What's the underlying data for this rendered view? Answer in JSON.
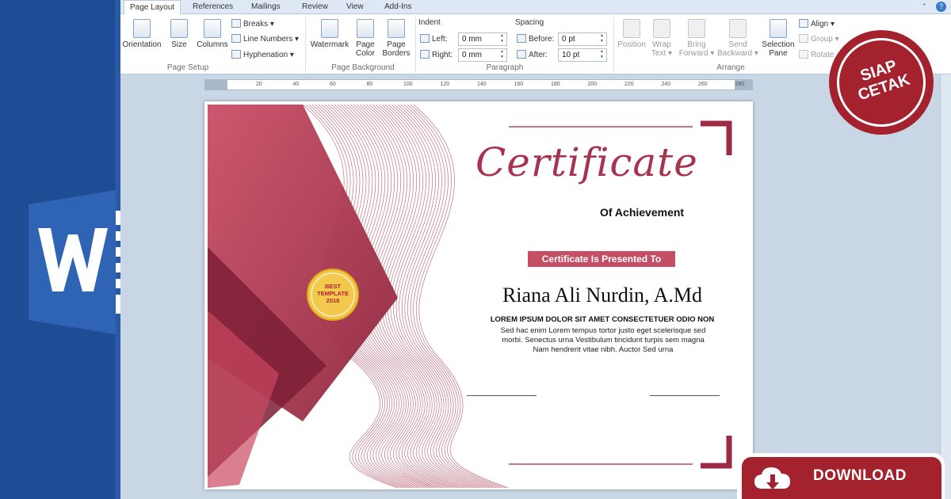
{
  "ribbon": {
    "tabs": [
      "Page Layout",
      "References",
      "Mailings",
      "Review",
      "View",
      "Add-Ins"
    ],
    "active_tab": "Page Layout",
    "page_setup": {
      "orientation": "Orientation",
      "size": "Size",
      "columns": "Columns",
      "breaks": "Breaks",
      "line_numbers": "Line Numbers",
      "hyphenation": "Hyphenation",
      "label": "Page Setup"
    },
    "page_background": {
      "watermark": "Watermark",
      "page_color_1": "Page",
      "page_color_2": "Color",
      "page_borders_1": "Page",
      "page_borders_2": "Borders",
      "label": "Page Background"
    },
    "paragraph": {
      "indent_label": "Indent",
      "left_label": "Left:",
      "left_value": "0 mm",
      "right_label": "Right:",
      "right_value": "0 mm",
      "spacing_label": "Spacing",
      "before_label": "Before:",
      "before_value": "0 pt",
      "after_label": "After:",
      "after_value": "10 pt",
      "label": "Paragraph"
    },
    "arrange": {
      "position": "Position",
      "wrap_1": "Wrap",
      "wrap_2": "Text",
      "bring_1": "Bring",
      "bring_2": "Forward",
      "send_1": "Send",
      "send_2": "Backward",
      "selection_1": "Selection",
      "selection_2": "Pane",
      "align": "Align",
      "group": "Group",
      "rotate": "Rotate",
      "label": "Arrange"
    }
  },
  "ruler": {
    "ticks": [
      "20",
      "40",
      "60",
      "80",
      "100",
      "120",
      "140",
      "160",
      "180",
      "200",
      "220",
      "240",
      "260",
      "280"
    ]
  },
  "certificate": {
    "title": "Certificate",
    "subtitle": "Of Achievement",
    "presented_to": "Certificate Is Presented To",
    "recipient": "Riana Ali Nurdin, A.Md",
    "headline": "LOREM IPSUM DOLOR SIT AMET CONSECTETUER ODIO NON",
    "body": [
      "Sed hac enim Lorem tempus tortor justo eget scelerisque sed",
      "morbi. Senectus urna Vestibulum tincidunt turpis sem magna",
      "Nam hendrerit vitae nibh. Auctor Sed urna"
    ],
    "badge": [
      "BEST",
      "TEMPLATE",
      "2018"
    ]
  },
  "stamp": {
    "line1": "SIAP",
    "line2": "CETAK"
  },
  "download": {
    "label": "DOWNLOAD"
  },
  "colors": {
    "brand_blue": "#1e4d96",
    "accent_red": "#a3222d",
    "certificate_pink": "#c44e63"
  }
}
